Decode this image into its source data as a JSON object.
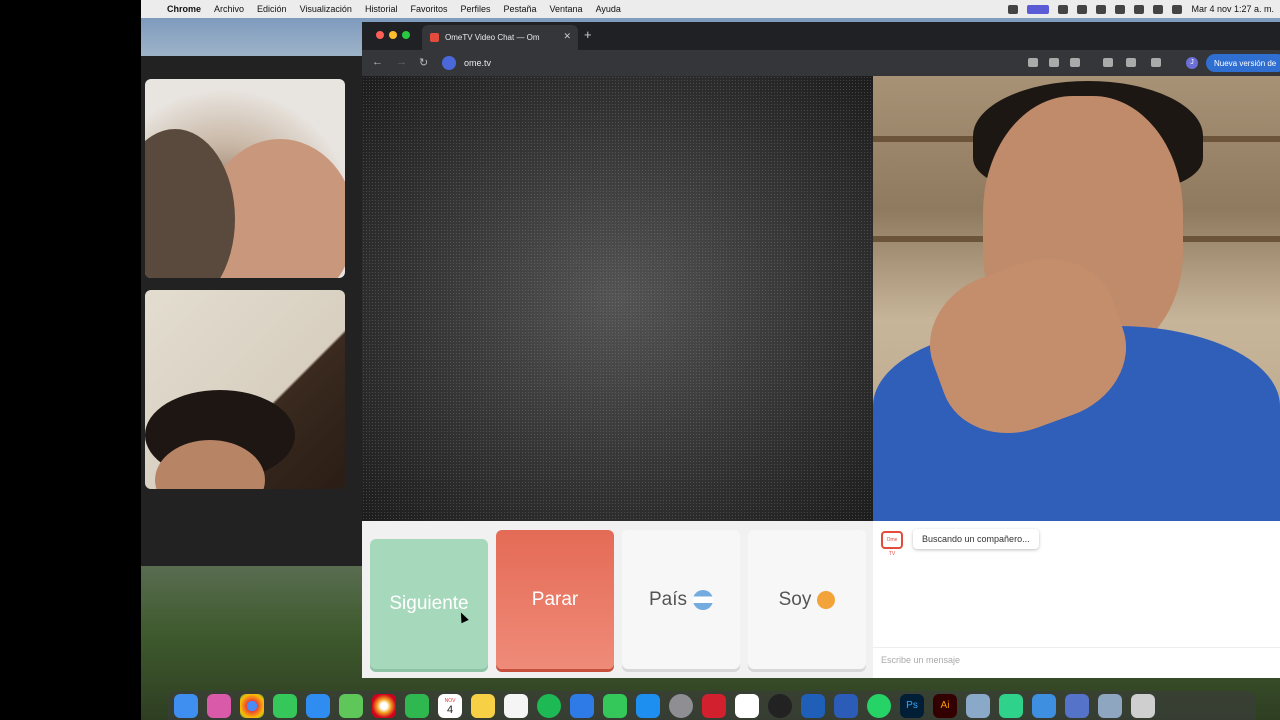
{
  "menubar": {
    "apple": "",
    "app_name": "Chrome",
    "menus": [
      "Archivo",
      "Edición",
      "Visualización",
      "Historial",
      "Favoritos",
      "Perfiles",
      "Pestaña",
      "Ventana",
      "Ayuda"
    ],
    "clock": "Mar 4 nov 1:27 a. m."
  },
  "browser": {
    "tab_title": "OmeTV Video Chat — Om",
    "url": "ome.tv",
    "profile_initial": "J",
    "update_label": "Nueva versión de"
  },
  "controls": {
    "next_label": "Siguiente",
    "stop_label": "Parar",
    "country_label": "País",
    "me_label": "Soy"
  },
  "chat": {
    "logo_text": "Ome TV",
    "status_message": "Buscando un compañero...",
    "input_placeholder": "Escribe un mensaje"
  },
  "colors": {
    "next_button": "#a6d8bb",
    "stop_button": "#e46b56",
    "accent_blue": "#2f6fd1"
  },
  "dock": {
    "calendar_day": "4",
    "calendar_month": "NOV"
  }
}
